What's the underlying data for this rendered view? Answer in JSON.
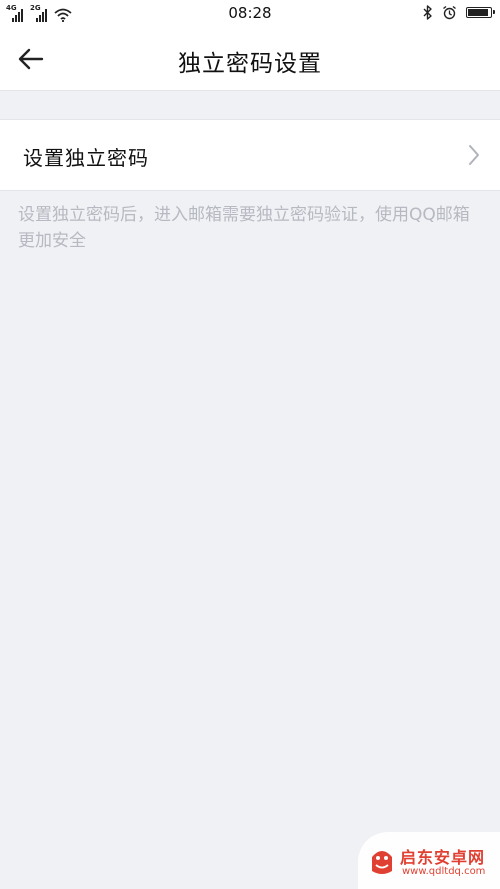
{
  "status_bar": {
    "time": "08:28",
    "network_1": "4G",
    "network_2": "2G",
    "battery_level": 0.9,
    "icons": [
      "signal-icon",
      "signal-icon",
      "wifi-icon",
      "bluetooth-icon",
      "alarm-icon",
      "battery-icon"
    ]
  },
  "header": {
    "back_icon": "arrow-left-icon",
    "title": "独立密码设置"
  },
  "settings": {
    "row_label": "设置独立密码",
    "row_icon": "chevron-right-icon"
  },
  "hint": "设置独立密码后，进入邮箱需要独立密码验证，使用QQ邮箱更加安全",
  "watermark": {
    "name": "启东安卓网",
    "url": "www.qdltdq.com",
    "color": "#e03b2b"
  },
  "colors": {
    "background": "#f0f1f5",
    "surface": "#ffffff",
    "text": "#111111",
    "hint": "#b6b9c1",
    "chevron": "#b0b3ba"
  }
}
